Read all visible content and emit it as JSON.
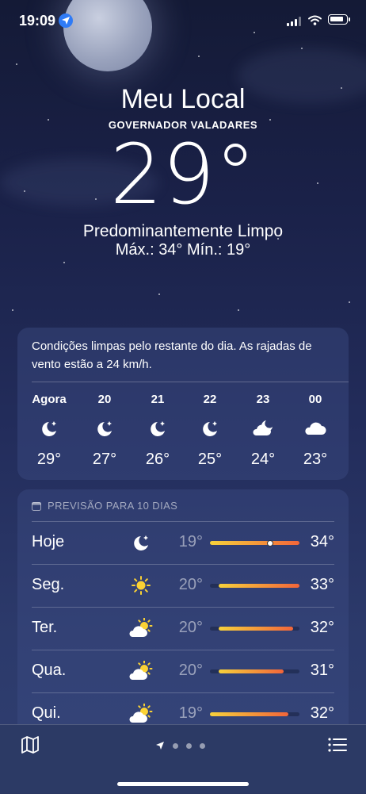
{
  "status_bar": {
    "time": "19:09"
  },
  "header": {
    "title": "Meu Local",
    "subtitle": "GOVERNADOR VALADARES",
    "temperature": "29°",
    "condition": "Predominantemente Limpo",
    "hilo": "Máx.: 34°  Mín.: 19°"
  },
  "hourly": {
    "description": "Condições limpas pelo restante do dia. As rajadas de vento estão a 24 km/h.",
    "items": [
      {
        "hour": "Agora",
        "icon": "moon-stars-icon",
        "temp": "29°"
      },
      {
        "hour": "20",
        "icon": "moon-stars-icon",
        "temp": "27°"
      },
      {
        "hour": "21",
        "icon": "moon-stars-icon",
        "temp": "26°"
      },
      {
        "hour": "22",
        "icon": "moon-stars-icon",
        "temp": "25°"
      },
      {
        "hour": "23",
        "icon": "cloud-moon-icon",
        "temp": "24°"
      },
      {
        "hour": "00",
        "icon": "cloud-icon",
        "temp": "23°"
      }
    ]
  },
  "daily": {
    "header": "PREVISÃO PARA 10 DIAS",
    "items": [
      {
        "day": "Hoje",
        "icon": "moon-stars-icon",
        "low": "19°",
        "high": "34°",
        "range_start": 0.0,
        "range_end": 1.0,
        "current": 0.67
      },
      {
        "day": "Seg.",
        "icon": "sun-icon",
        "low": "20°",
        "high": "33°",
        "range_start": 0.1,
        "range_end": 1.0
      },
      {
        "day": "Ter.",
        "icon": "cloud-sun-icon",
        "low": "20°",
        "high": "32°",
        "range_start": 0.1,
        "range_end": 0.93
      },
      {
        "day": "Qua.",
        "icon": "cloud-sun-icon",
        "low": "20°",
        "high": "31°",
        "range_start": 0.1,
        "range_end": 0.82
      },
      {
        "day": "Qui.",
        "icon": "cloud-sun-icon",
        "low": "19°",
        "high": "32°",
        "range_start": 0.0,
        "range_end": 0.88
      }
    ]
  },
  "colors": {
    "bar_start": "#f7d13b",
    "bar_end": "#f2653a",
    "sun": "#fbd234"
  }
}
